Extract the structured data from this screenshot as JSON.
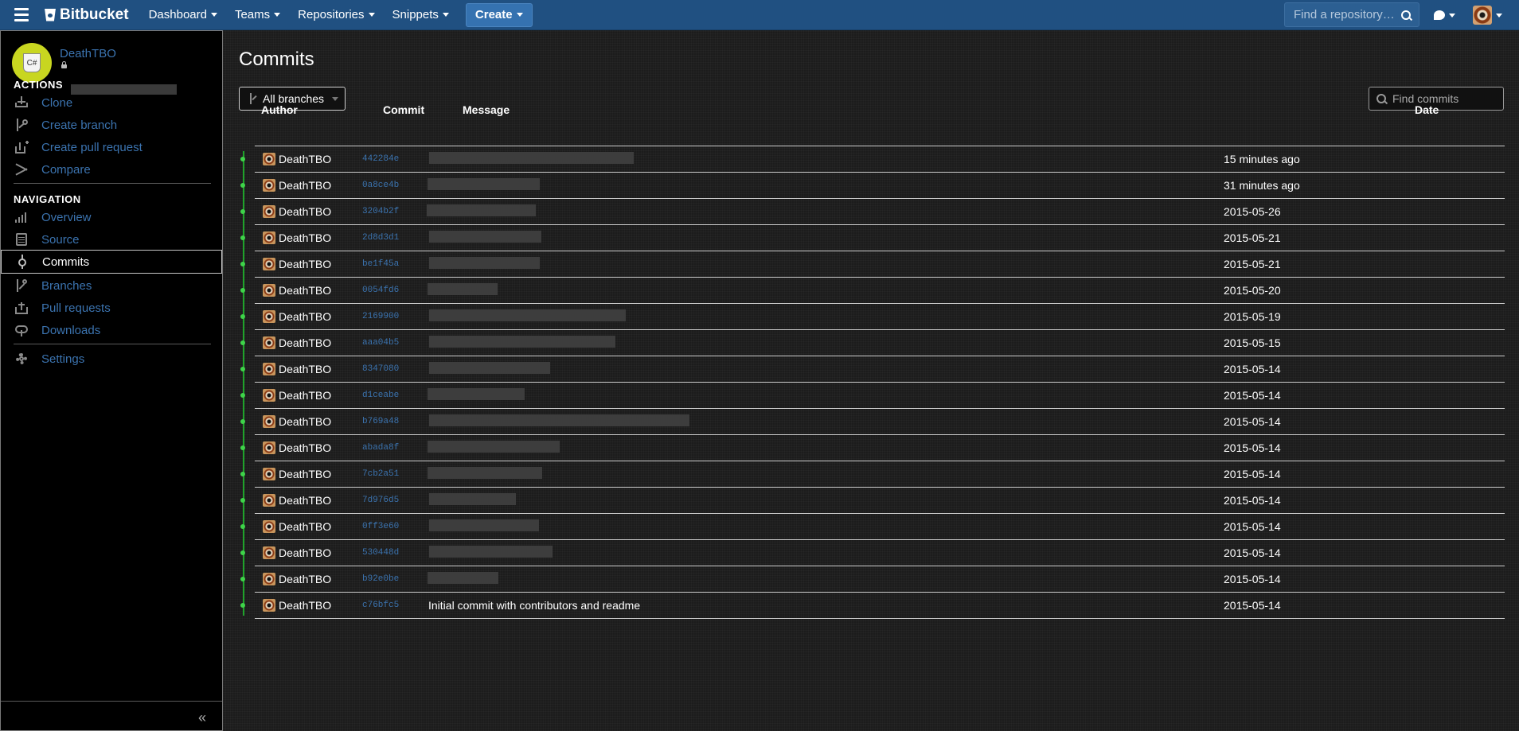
{
  "topbar": {
    "brand": "Bitbucket",
    "nav": [
      "Dashboard",
      "Teams",
      "Repositories",
      "Snippets"
    ],
    "create_label": "Create",
    "search_placeholder": "Find a repository…",
    "accent": "#205081"
  },
  "sidebar": {
    "repo_owner": "DeathTBO",
    "repo_avatar_text": "C#",
    "actions_title": "ACTIONS",
    "actions": [
      {
        "label": "Clone",
        "icon": "download-icon"
      },
      {
        "label": "Create branch",
        "icon": "branch-plus-icon"
      },
      {
        "label": "Create pull request",
        "icon": "pull-request-plus-icon"
      },
      {
        "label": "Compare",
        "icon": "shuffle-icon"
      }
    ],
    "navigation_title": "NAVIGATION",
    "navigation": [
      {
        "label": "Overview",
        "icon": "bar-chart-icon"
      },
      {
        "label": "Source",
        "icon": "document-icon"
      },
      {
        "label": "Commits",
        "icon": "commit-icon",
        "active": true
      },
      {
        "label": "Branches",
        "icon": "branch-icon"
      },
      {
        "label": "Pull requests",
        "icon": "pull-request-icon"
      },
      {
        "label": "Downloads",
        "icon": "cloud-download-icon"
      }
    ],
    "settings_label": "Settings",
    "collapse_label": "«"
  },
  "main": {
    "title": "Commits",
    "branch_filter": "All branches",
    "find_placeholder": "Find commits",
    "columns": {
      "author": "Author",
      "commit": "Commit",
      "message": "Message",
      "date": "Date"
    },
    "commits": [
      {
        "author": "DeathTBO",
        "hash": "442284e",
        "message": "",
        "date": "15 minutes ago"
      },
      {
        "author": "DeathTBO",
        "hash": "0a8ce4b",
        "message": "",
        "date": "31 minutes ago"
      },
      {
        "author": "DeathTBO",
        "hash": "3204b2f",
        "message": "",
        "date": "2015-05-26"
      },
      {
        "author": "DeathTBO",
        "hash": "2d8d3d1",
        "message": "",
        "date": "2015-05-21"
      },
      {
        "author": "DeathTBO",
        "hash": "be1f45a",
        "message": "",
        "date": "2015-05-21"
      },
      {
        "author": "DeathTBO",
        "hash": "0054fd6",
        "message": "",
        "date": "2015-05-20"
      },
      {
        "author": "DeathTBO",
        "hash": "2169900",
        "message": "",
        "date": "2015-05-19"
      },
      {
        "author": "DeathTBO",
        "hash": "aaa04b5",
        "message": "",
        "date": "2015-05-15"
      },
      {
        "author": "DeathTBO",
        "hash": "8347080",
        "message": "",
        "date": "2015-05-14"
      },
      {
        "author": "DeathTBO",
        "hash": "d1ceabe",
        "message": "",
        "date": "2015-05-14"
      },
      {
        "author": "DeathTBO",
        "hash": "b769a48",
        "message": "",
        "date": "2015-05-14"
      },
      {
        "author": "DeathTBO",
        "hash": "abada8f",
        "message": "",
        "date": "2015-05-14"
      },
      {
        "author": "DeathTBO",
        "hash": "7cb2a51",
        "message": "",
        "date": "2015-05-14"
      },
      {
        "author": "DeathTBO",
        "hash": "7d976d5",
        "message": "",
        "date": "2015-05-14"
      },
      {
        "author": "DeathTBO",
        "hash": "0ff3e60",
        "message": "",
        "date": "2015-05-14"
      },
      {
        "author": "DeathTBO",
        "hash": "530448d",
        "message": "",
        "date": "2015-05-14"
      },
      {
        "author": "DeathTBO",
        "hash": "b92e0be",
        "message": "",
        "date": "2015-05-14"
      },
      {
        "author": "DeathTBO",
        "hash": "c76bfc5",
        "message": "Initial commit with contributors and readme",
        "date": "2015-05-14"
      }
    ]
  }
}
